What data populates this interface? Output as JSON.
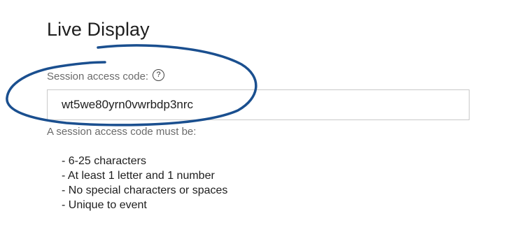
{
  "page": {
    "title": "Live Display"
  },
  "session_code": {
    "label": "Session access code:",
    "help_icon": "question-circle-icon",
    "value": "wt5we80yrn0vwrbdp3nrc",
    "helper": "A session access code must be:",
    "rules": [
      "- 6-25 characters",
      "- At least 1 letter and 1 number",
      "- No special characters or spaces",
      "- Unique to event"
    ]
  },
  "annotation": {
    "color": "#1a4f8f"
  }
}
